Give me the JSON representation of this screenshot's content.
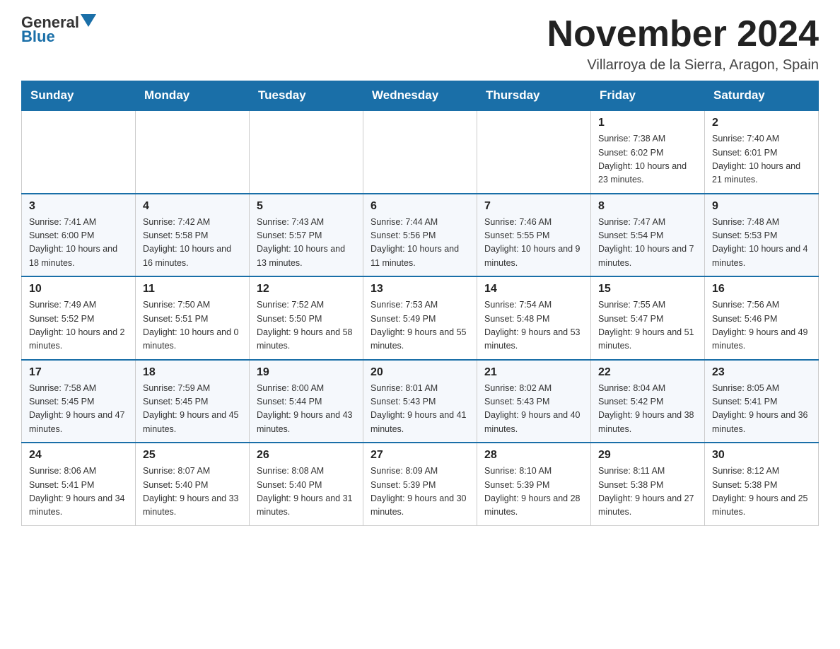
{
  "header": {
    "logo_line1": "General",
    "logo_line2": "Blue",
    "month_title": "November 2024",
    "location": "Villarroya de la Sierra, Aragon, Spain"
  },
  "weekdays": [
    "Sunday",
    "Monday",
    "Tuesday",
    "Wednesday",
    "Thursday",
    "Friday",
    "Saturday"
  ],
  "rows": [
    [
      {
        "day": "",
        "info": ""
      },
      {
        "day": "",
        "info": ""
      },
      {
        "day": "",
        "info": ""
      },
      {
        "day": "",
        "info": ""
      },
      {
        "day": "",
        "info": ""
      },
      {
        "day": "1",
        "info": "Sunrise: 7:38 AM\nSunset: 6:02 PM\nDaylight: 10 hours and 23 minutes."
      },
      {
        "day": "2",
        "info": "Sunrise: 7:40 AM\nSunset: 6:01 PM\nDaylight: 10 hours and 21 minutes."
      }
    ],
    [
      {
        "day": "3",
        "info": "Sunrise: 7:41 AM\nSunset: 6:00 PM\nDaylight: 10 hours and 18 minutes."
      },
      {
        "day": "4",
        "info": "Sunrise: 7:42 AM\nSunset: 5:58 PM\nDaylight: 10 hours and 16 minutes."
      },
      {
        "day": "5",
        "info": "Sunrise: 7:43 AM\nSunset: 5:57 PM\nDaylight: 10 hours and 13 minutes."
      },
      {
        "day": "6",
        "info": "Sunrise: 7:44 AM\nSunset: 5:56 PM\nDaylight: 10 hours and 11 minutes."
      },
      {
        "day": "7",
        "info": "Sunrise: 7:46 AM\nSunset: 5:55 PM\nDaylight: 10 hours and 9 minutes."
      },
      {
        "day": "8",
        "info": "Sunrise: 7:47 AM\nSunset: 5:54 PM\nDaylight: 10 hours and 7 minutes."
      },
      {
        "day": "9",
        "info": "Sunrise: 7:48 AM\nSunset: 5:53 PM\nDaylight: 10 hours and 4 minutes."
      }
    ],
    [
      {
        "day": "10",
        "info": "Sunrise: 7:49 AM\nSunset: 5:52 PM\nDaylight: 10 hours and 2 minutes."
      },
      {
        "day": "11",
        "info": "Sunrise: 7:50 AM\nSunset: 5:51 PM\nDaylight: 10 hours and 0 minutes."
      },
      {
        "day": "12",
        "info": "Sunrise: 7:52 AM\nSunset: 5:50 PM\nDaylight: 9 hours and 58 minutes."
      },
      {
        "day": "13",
        "info": "Sunrise: 7:53 AM\nSunset: 5:49 PM\nDaylight: 9 hours and 55 minutes."
      },
      {
        "day": "14",
        "info": "Sunrise: 7:54 AM\nSunset: 5:48 PM\nDaylight: 9 hours and 53 minutes."
      },
      {
        "day": "15",
        "info": "Sunrise: 7:55 AM\nSunset: 5:47 PM\nDaylight: 9 hours and 51 minutes."
      },
      {
        "day": "16",
        "info": "Sunrise: 7:56 AM\nSunset: 5:46 PM\nDaylight: 9 hours and 49 minutes."
      }
    ],
    [
      {
        "day": "17",
        "info": "Sunrise: 7:58 AM\nSunset: 5:45 PM\nDaylight: 9 hours and 47 minutes."
      },
      {
        "day": "18",
        "info": "Sunrise: 7:59 AM\nSunset: 5:45 PM\nDaylight: 9 hours and 45 minutes."
      },
      {
        "day": "19",
        "info": "Sunrise: 8:00 AM\nSunset: 5:44 PM\nDaylight: 9 hours and 43 minutes."
      },
      {
        "day": "20",
        "info": "Sunrise: 8:01 AM\nSunset: 5:43 PM\nDaylight: 9 hours and 41 minutes."
      },
      {
        "day": "21",
        "info": "Sunrise: 8:02 AM\nSunset: 5:43 PM\nDaylight: 9 hours and 40 minutes."
      },
      {
        "day": "22",
        "info": "Sunrise: 8:04 AM\nSunset: 5:42 PM\nDaylight: 9 hours and 38 minutes."
      },
      {
        "day": "23",
        "info": "Sunrise: 8:05 AM\nSunset: 5:41 PM\nDaylight: 9 hours and 36 minutes."
      }
    ],
    [
      {
        "day": "24",
        "info": "Sunrise: 8:06 AM\nSunset: 5:41 PM\nDaylight: 9 hours and 34 minutes."
      },
      {
        "day": "25",
        "info": "Sunrise: 8:07 AM\nSunset: 5:40 PM\nDaylight: 9 hours and 33 minutes."
      },
      {
        "day": "26",
        "info": "Sunrise: 8:08 AM\nSunset: 5:40 PM\nDaylight: 9 hours and 31 minutes."
      },
      {
        "day": "27",
        "info": "Sunrise: 8:09 AM\nSunset: 5:39 PM\nDaylight: 9 hours and 30 minutes."
      },
      {
        "day": "28",
        "info": "Sunrise: 8:10 AM\nSunset: 5:39 PM\nDaylight: 9 hours and 28 minutes."
      },
      {
        "day": "29",
        "info": "Sunrise: 8:11 AM\nSunset: 5:38 PM\nDaylight: 9 hours and 27 minutes."
      },
      {
        "day": "30",
        "info": "Sunrise: 8:12 AM\nSunset: 5:38 PM\nDaylight: 9 hours and 25 minutes."
      }
    ]
  ]
}
